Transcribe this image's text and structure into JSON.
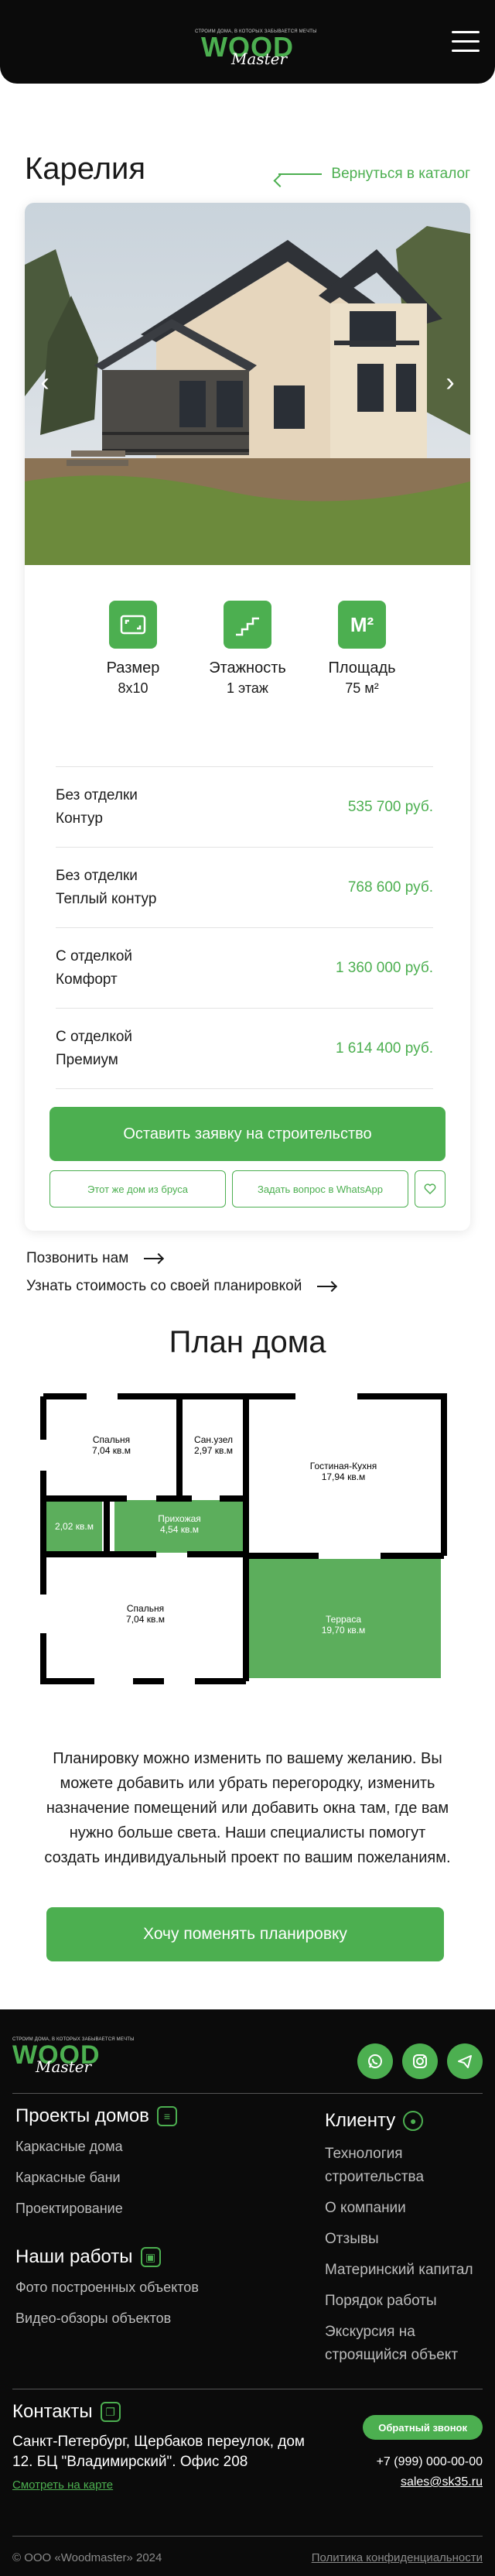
{
  "header": {
    "logo_tagline": "СТРОИМ ДОМА, В КОТОРЫХ ЗАБЫВАЕТСЯ МЕЧТЫ",
    "logo_word": "WOOD",
    "logo_script": "Master"
  },
  "page": {
    "title": "Карелия",
    "back_link": "Вернуться в каталог"
  },
  "specs": [
    {
      "label": "Размер",
      "value": "8x10",
      "icon": "size-icon"
    },
    {
      "label": "Этажность",
      "value": "1 этаж",
      "icon": "stairs-icon"
    },
    {
      "label": "Площадь",
      "value": "75 м²",
      "icon": "area-icon",
      "icon_text": "М²"
    }
  ],
  "prices": [
    {
      "line1": "Без отделки",
      "line2": "Контур",
      "price": "535 700 руб."
    },
    {
      "line1": "Без отделки",
      "line2": "Теплый контур",
      "price": "768 600 руб."
    },
    {
      "line1": "С отделкой",
      "line2": "Комфорт",
      "price": "1 360 000 руб."
    },
    {
      "line1": "С отделкой",
      "line2": "Премиум",
      "price": "1 614 400 руб."
    }
  ],
  "buttons": {
    "order": "Оставить заявку на строительство",
    "same_timber": "Этот же дом из бруса",
    "whatsapp": "Задать вопрос в WhatsApp"
  },
  "links": {
    "call": "Позвонить нам",
    "own_plan": "Узнать стоимость со своей планировкой"
  },
  "plan": {
    "title": "План дома",
    "rooms": [
      {
        "name": "Спальня",
        "area": "7,04 кв.м"
      },
      {
        "name": "Сан.узел",
        "area": "2,97 кв.м"
      },
      {
        "name": "Гостиная-Кухня",
        "area": "17,94 кв.м"
      },
      {
        "name": "",
        "area": "2,02 кв.м"
      },
      {
        "name": "Прихожая",
        "area": "4,54 кв.м"
      },
      {
        "name": "Спальня",
        "area": "7,04 кв.м"
      },
      {
        "name": "Терраса",
        "area": "19,70 кв.м"
      }
    ],
    "description": "Планировку можно изменить по вашему желанию. Вы можете добавить или убрать перегородку, изменить назначение помещений или добавить окна там, где вам нужно больше света. Наши специалисты помогут создать индивидуальный проект по вашим пожеланиям.",
    "cta": "Хочу поменять планировку"
  },
  "footer": {
    "projects_title": "Проекты домов",
    "projects": [
      "Каркасные дома",
      "Каркасные бани",
      "Проектирование"
    ],
    "works_title": "Наши работы",
    "works": [
      "Фото построенных объектов",
      "Видео-обзоры объектов"
    ],
    "client_title": "Клиенту",
    "client_items": [
      "Технология строительства",
      "О компании",
      "Отзывы",
      "Материнский капитал",
      "Порядок работы",
      "Экскурсия на строящийся объект"
    ],
    "contacts_title": "Контакты",
    "address": "Санкт-Петербург, Щербаков переулок, дом 12. БЦ \"Владимирский\". Офис 208",
    "map_link": "Смотреть на карте",
    "callback": "Обратный звонок",
    "phone": "+7 (999) 000-00-00",
    "email": "sales@sk35.ru",
    "copyright": "© ООО «Woodmaster» 2024",
    "privacy": "Политика конфиденциальности"
  },
  "colors": {
    "accent": "#4caf50",
    "dark": "#0b0b0b",
    "text": "#1a1a1a"
  }
}
